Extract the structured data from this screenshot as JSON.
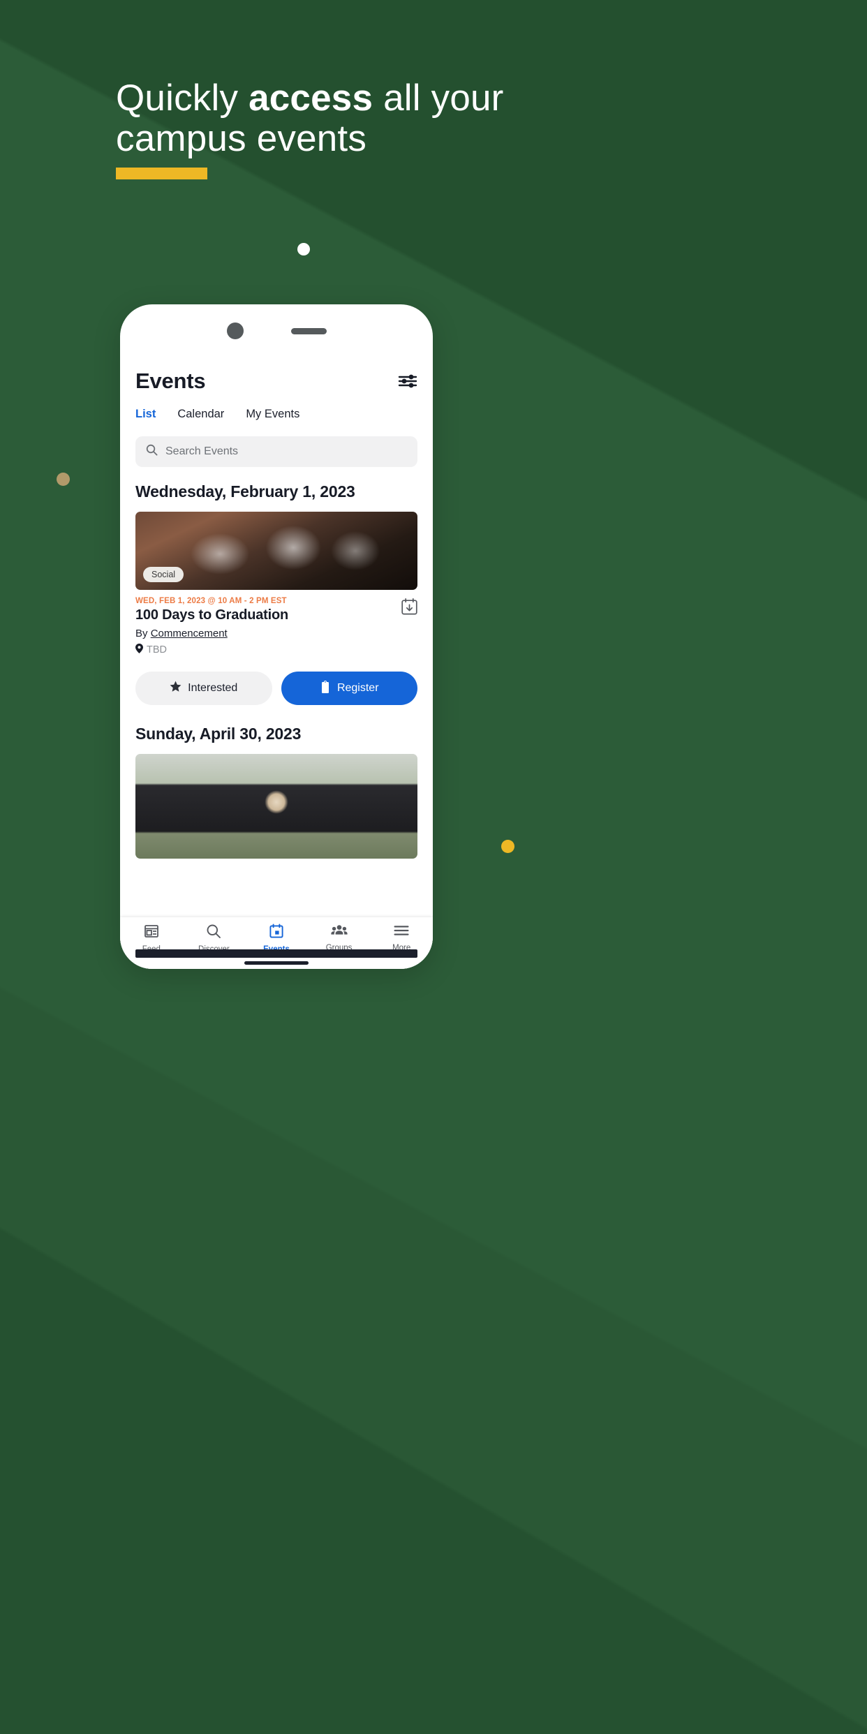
{
  "hero": {
    "headline_part1": "Quickly ",
    "headline_bold": "access",
    "headline_part2": " all your campus events",
    "accent_color": "#eeb825",
    "background_color": "#2c5c38"
  },
  "carousel": {
    "active_dot": "page-indicator-dot"
  },
  "decor": {
    "dot_tan_color": "#b29a6a",
    "dot_yellow_color": "#eeb825",
    "dot_white_color": "#ffffff"
  },
  "phone": {
    "app": {
      "title": "Events",
      "filter_icon": "sliders-icon",
      "tabs": [
        {
          "label": "List",
          "active": true
        },
        {
          "label": "Calendar",
          "active": false
        },
        {
          "label": "My Events",
          "active": false
        }
      ],
      "active_tab_color": "#1565d8",
      "search": {
        "placeholder": "Search Events",
        "icon": "search-icon"
      },
      "sections": [
        {
          "date_heading": "Wednesday, February 1, 2023",
          "event": {
            "badge": "Social",
            "time": "WED, FEB 1, 2023 @ 10 AM - 2 PM EST",
            "time_color": "#ec7b45",
            "title": "100 Days to Graduation",
            "by_prefix": "By ",
            "by_org": "Commencement",
            "location": "TBD",
            "location_icon": "map-pin-icon",
            "add_to_calendar_icon": "calendar-add-icon",
            "buttons": {
              "interested": {
                "label": "Interested",
                "icon": "star-icon"
              },
              "register": {
                "label": "Register",
                "icon": "clipboard-icon",
                "color": "#1565d8"
              }
            }
          }
        },
        {
          "date_heading": "Sunday, April 30, 2023",
          "event": {
            "badge": "",
            "time": "",
            "title": "",
            "by_prefix": "",
            "by_org": "",
            "location": ""
          }
        }
      ],
      "bottom_nav": [
        {
          "label": "Feed",
          "icon": "feed-icon",
          "active": false
        },
        {
          "label": "Discover",
          "icon": "search-icon",
          "active": false
        },
        {
          "label": "Events",
          "icon": "calendar-icon",
          "active": true
        },
        {
          "label": "Groups",
          "icon": "people-icon",
          "active": false
        },
        {
          "label": "More",
          "icon": "hamburger-icon",
          "active": false
        }
      ]
    }
  }
}
